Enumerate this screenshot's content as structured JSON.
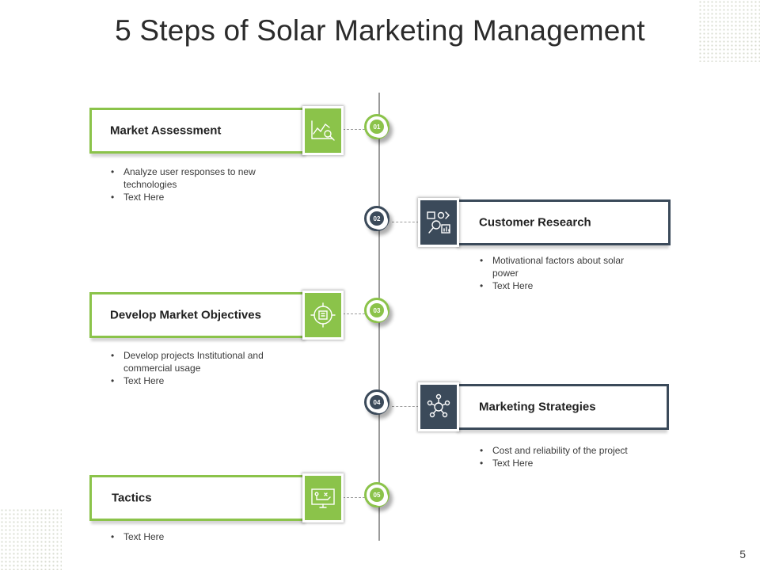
{
  "title": "5 Steps of Solar Marketing Management",
  "page_number": "5",
  "colors": {
    "green": "#8bc34a",
    "dark": "#3b4a5a"
  },
  "steps": [
    {
      "number": "01",
      "label": "Market Assessment",
      "icon": "chart-magnifier-icon",
      "bullets": [
        "Analyze user responses to new technologies",
        "Text Here"
      ]
    },
    {
      "number": "02",
      "label": "Customer Research",
      "icon": "research-analytics-icon",
      "bullets": [
        "Motivational factors about solar power",
        "Text Here"
      ]
    },
    {
      "number": "03",
      "label": "Develop Market Objectives",
      "icon": "target-objectives-icon",
      "bullets": [
        "Develop  projects Institutional and commercial usage",
        "Text Here"
      ]
    },
    {
      "number": "04",
      "label": "Marketing Strategies",
      "icon": "strategy-network-icon",
      "bullets": [
        "Cost and reliability of the project",
        "Text Here"
      ]
    },
    {
      "number": "05",
      "label": "Tactics",
      "icon": "tactics-board-icon",
      "bullets": [
        "Text Here"
      ]
    }
  ]
}
